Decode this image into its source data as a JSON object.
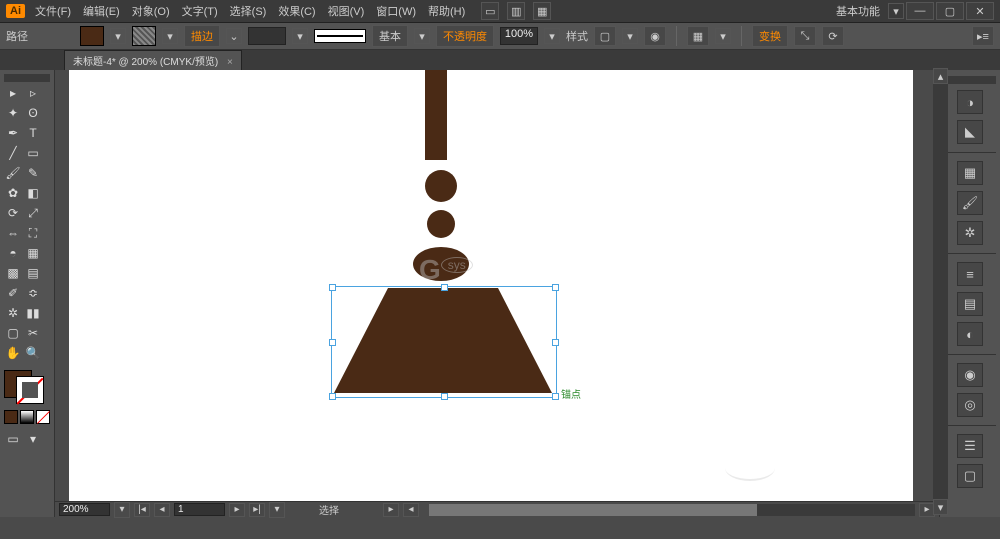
{
  "title_logo": "Ai",
  "menu": {
    "file": "文件(F)",
    "edit": "编辑(E)",
    "object": "对象(O)",
    "type": "文字(T)",
    "select": "选择(S)",
    "effect": "效果(C)",
    "view": "视图(V)",
    "window": "窗口(W)",
    "help": "帮助(H)"
  },
  "workspace_label": "基本功能",
  "control": {
    "path_label": "路径",
    "stroke_label": "描边",
    "stroke_dd": "基本",
    "opacity_label": "不透明度",
    "opacity_value": "100%",
    "style_label": "样式",
    "transform_label": "变换"
  },
  "doc_tab": "未标题-4* @ 200% (CMYK/预览)",
  "status": {
    "zoom": "200%",
    "page": "1",
    "tool": "选择"
  },
  "anchor_hint": "锚点",
  "watermark_main": "G",
  "watermark_sub": "sys"
}
